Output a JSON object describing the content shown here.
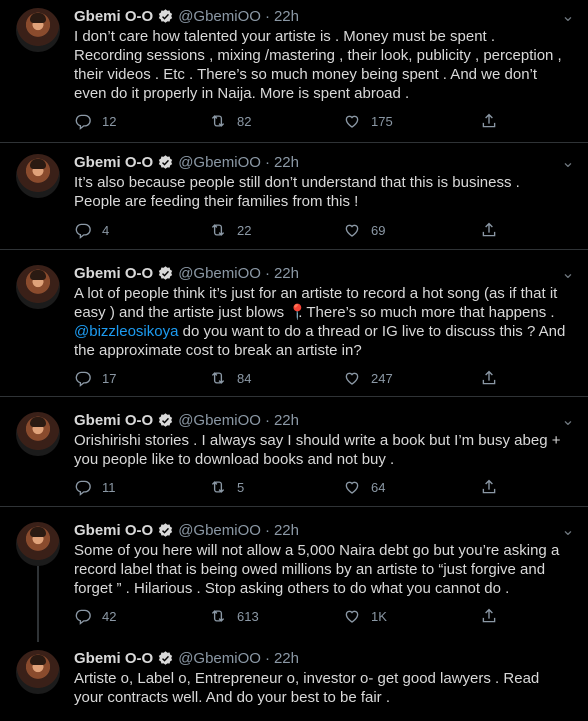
{
  "tweets": [
    {
      "name": "Gbemi O-O",
      "handle": "@GbemiOO",
      "dot": "·",
      "time": "22h",
      "lines": [
        "I don’t care how talented your artiste is . Money must be spent .",
        "Recording sessions , mixing /mastering , their look, publicity , perception ,",
        "their videos . Etc . There’s so much money being spent . And we don’t",
        "even do it properly in Naija. More is spent abroad ."
      ],
      "replies": "12",
      "retweets": "82",
      "likes": "175"
    },
    {
      "name": "Gbemi O-O",
      "handle": "@GbemiOO",
      "dot": "·",
      "time": "22h",
      "lines": [
        "It’s also because people still don’t understand that this is business .",
        "People are feeding their families from this !"
      ],
      "replies": "4",
      "retweets": "22",
      "likes": "69"
    },
    {
      "name": "Gbemi O-O",
      "handle": "@GbemiOO",
      "dot": "·",
      "time": "22h",
      "line1": "A lot of people think it’s just for an artiste to record a hot song (as if that it",
      "line2_a": "easy ) and the artiste just blows",
      "line2_emoji": "📍",
      "line2_b": ". There’s so much more that happens .",
      "mention": "@bizzleosikoya",
      "line3_rest": " do you want to do a thread or IG live to discuss this ? And",
      "line4": "the approximate cost to break an artiste in?",
      "replies": "17",
      "retweets": "84",
      "likes": "247"
    },
    {
      "name": "Gbemi O-O",
      "handle": "@GbemiOO",
      "dot": "·",
      "time": "22h",
      "lines": [
        "Orishirishi stories . I always say I should write a book but I’m busy abeg +",
        "you people like to download books and not buy ."
      ],
      "replies": "11",
      "retweets": "5",
      "likes": "64"
    },
    {
      "name": "Gbemi O-O",
      "handle": "@GbemiOO",
      "dot": "·",
      "time": "22h",
      "lines": [
        "Some of you here will not allow a 5,000 Naira debt go but you’re asking a",
        "record label that is being owed millions by an artiste to “just forgive and",
        "forget ” . Hilarious . Stop asking others to do what you cannot do ."
      ],
      "replies": "42",
      "retweets": "613",
      "likes": "1K"
    },
    {
      "name": "Gbemi O-O",
      "handle": "@GbemiOO",
      "dot": "·",
      "time": "22h",
      "lines": [
        "Artiste o, Label o, Entrepreneur o, investor o- get good lawyers . Read",
        "your contracts well. And do your best to be fair ."
      ]
    }
  ],
  "icons": {
    "reply": "reply-icon",
    "retweet": "retweet-icon",
    "like": "like-icon",
    "share": "share-icon",
    "verified": "verified-badge-icon",
    "more": "chevron-down-icon"
  },
  "colors": {
    "background": "#000000",
    "text": "#d9d9d9",
    "secondary": "#8b98a5",
    "link": "#1d9bf0",
    "divider": "#2f3336"
  }
}
